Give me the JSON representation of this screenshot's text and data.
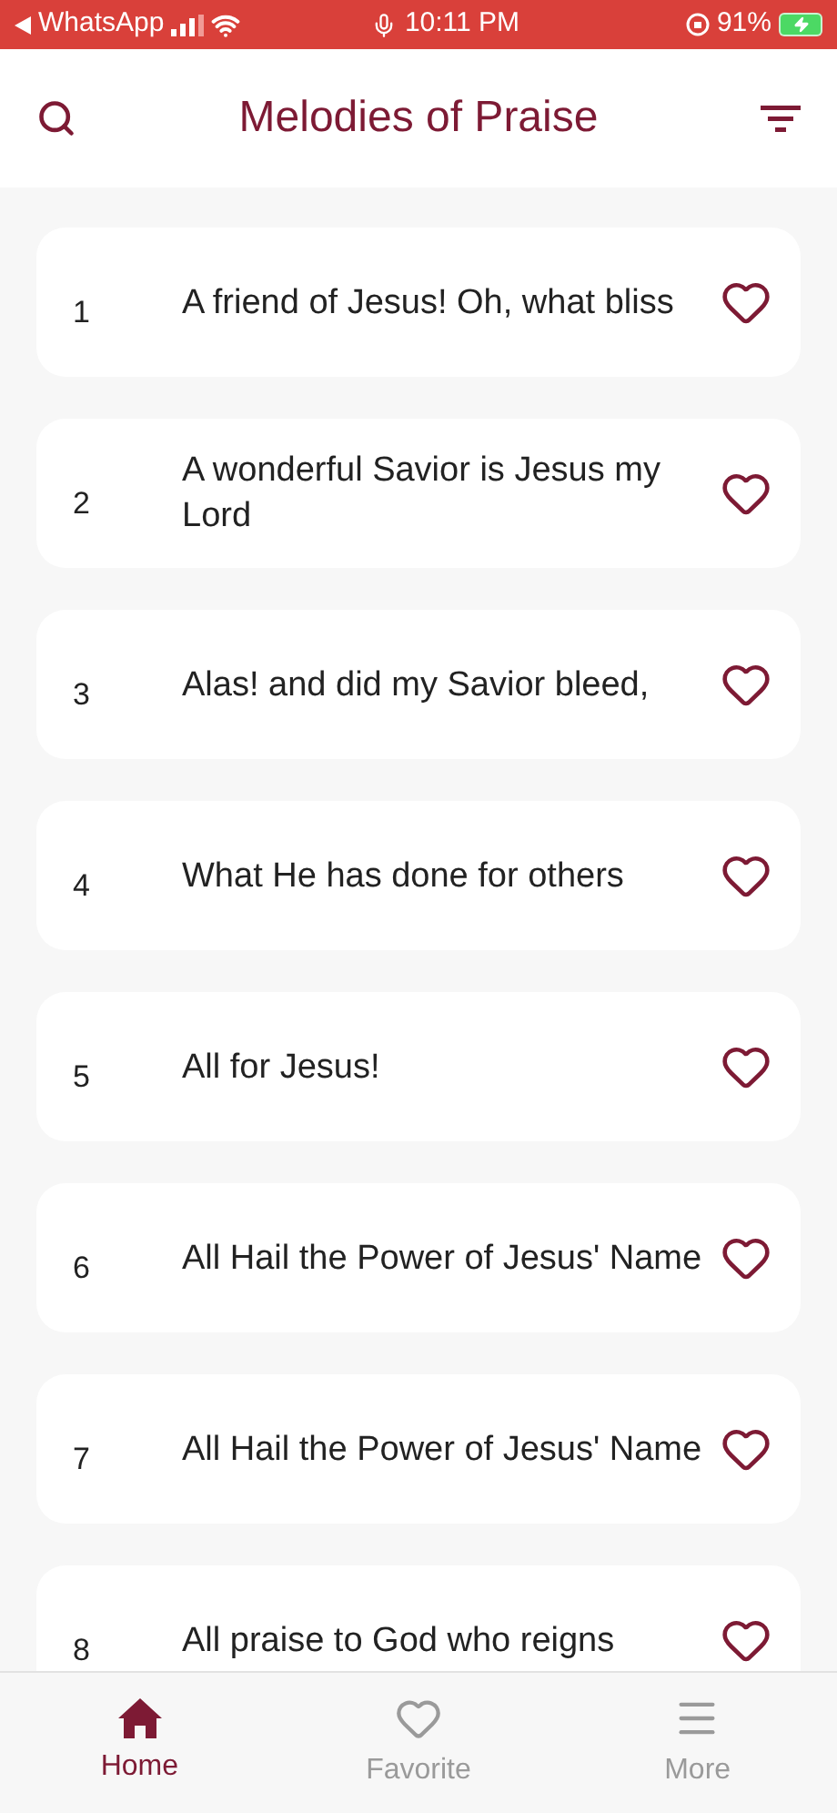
{
  "status_bar": {
    "back_app": "WhatsApp",
    "time": "10:11 PM",
    "battery": "91%"
  },
  "header": {
    "title": "Melodies of Praise"
  },
  "songs": [
    {
      "number": "1",
      "title": "A friend of Jesus! Oh, what bliss",
      "favorite": false
    },
    {
      "number": "2",
      "title": "A wonderful Savior is Jesus my Lord",
      "favorite": false
    },
    {
      "number": "3",
      "title": "Alas! and did my Savior bleed,",
      "favorite": false
    },
    {
      "number": "4",
      "title": "What He has done for others",
      "favorite": false
    },
    {
      "number": "5",
      "title": "All for Jesus!",
      "favorite": false
    },
    {
      "number": "6",
      "title": "All Hail the Power of Jesus' Name",
      "favorite": false
    },
    {
      "number": "7",
      "title": "All Hail the Power of Jesus' Name",
      "favorite": false
    },
    {
      "number": "8",
      "title": "All praise to God who reigns",
      "favorite": false
    }
  ],
  "tabs": [
    {
      "label": "Home",
      "kind": "home",
      "selected": true
    },
    {
      "label": "Favorite",
      "kind": "favorite",
      "selected": false
    },
    {
      "label": "More",
      "kind": "more",
      "selected": false
    }
  ]
}
